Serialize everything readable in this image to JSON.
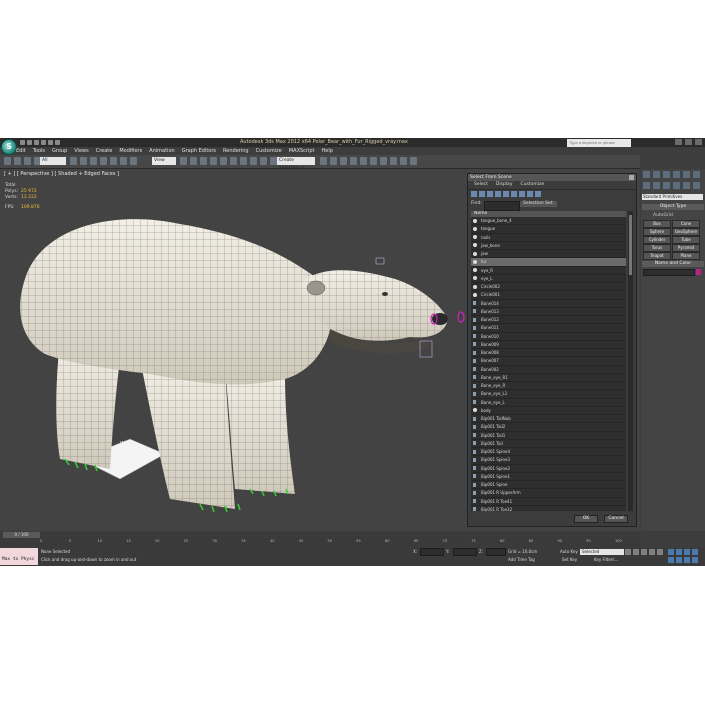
{
  "title_bar": {
    "app_title": "Autodesk 3ds Max 2012 x64    Polar_Bear_with_Fur_Rigged_vray.max",
    "search_placeholder": "Type a keyword or phrase"
  },
  "menu": [
    "Edit",
    "Tools",
    "Group",
    "Views",
    "Create",
    "Modifiers",
    "Animation",
    "Graph Editors",
    "Rendering",
    "Customize",
    "MAXScript",
    "Help"
  ],
  "toolbar": {
    "filter_value": "All",
    "view_value": "View",
    "selection_set_value": "Create Selection S"
  },
  "viewport": {
    "label": "[ + ] [ Perspective ] [ Shaded + Edged Faces ]",
    "total_label": "Total",
    "polys_label": "Polys:",
    "polys_value": "25 972",
    "verts_label": "Verts:",
    "verts_value": "13 222",
    "fps_label": "FPS:",
    "fps_value": "109.876",
    "helper_label": "Walks"
  },
  "select_dialog": {
    "title": "Select From Scene",
    "menu": [
      "Select",
      "Display",
      "Customize"
    ],
    "find_label": "Find:",
    "selection_set_label": "Selection Set:",
    "column_header": "Name",
    "items": [
      "tongue_bone_4",
      "tongue",
      "nails",
      "jaw_bone",
      "jaw",
      "fur",
      "eye_R",
      "eye_L",
      "Circle002",
      "Circle001",
      "Bone014",
      "Bone013",
      "Bone012",
      "Bone011",
      "Bone010",
      "Bone009",
      "Bone008",
      "Bone007",
      "Bone002",
      "Bone_eye_R1",
      "Bone_eye_R",
      "Bone_eye_L1",
      "Bone_eye_L",
      "body",
      "Bip001 TailNub",
      "Bip001 Tail2",
      "Bip001 Tail1",
      "Bip001 Tail",
      "Bip001 Spine4",
      "Bip001 Spine3",
      "Bip001 Spine2",
      "Bip001 Spine1",
      "Bip001 Spine",
      "Bip001 R UpperArm",
      "Bip001 R Toe41",
      "Bip001 R Toe32",
      "Bip001 R Toe31",
      "Bip001 R Toe22",
      "Bip001 R Toe21"
    ],
    "selected_index": 5,
    "ok_label": "OK",
    "cancel_label": "Cancel"
  },
  "command_panel": {
    "category_value": "Standard Primitives",
    "object_type_title": "Object Type",
    "autogrid_label": "AutoGrid",
    "buttons": [
      "Box",
      "Cone",
      "Sphere",
      "GeoSphere",
      "Cylinder",
      "Tube",
      "Torus",
      "Pyramid",
      "Teapot",
      "Plane"
    ],
    "name_color_title": "Name and Color",
    "swatch_color": "#c02080"
  },
  "timeline": {
    "slider_label": "0 / 100",
    "ticks": [
      "0",
      "5",
      "10",
      "15",
      "20",
      "25",
      "30",
      "35",
      "40",
      "45",
      "50",
      "55",
      "60",
      "65",
      "70",
      "75",
      "80",
      "85",
      "90",
      "95",
      "100"
    ]
  },
  "status_bar": {
    "maxscript_label": "Max to Physc",
    "status_text": "None Selected",
    "prompt_text": "Click and drag up-and-down to zoom in and out",
    "x_label": "X:",
    "y_label": "Y:",
    "z_label": "Z:",
    "grid_text": "Grid = 10,0cm",
    "add_time_tag": "Add Time Tag",
    "auto_key_label": "Auto Key",
    "set_key_label": "Set Key",
    "key_filters_label": "Key Filters...",
    "selected_value": "Selected"
  }
}
